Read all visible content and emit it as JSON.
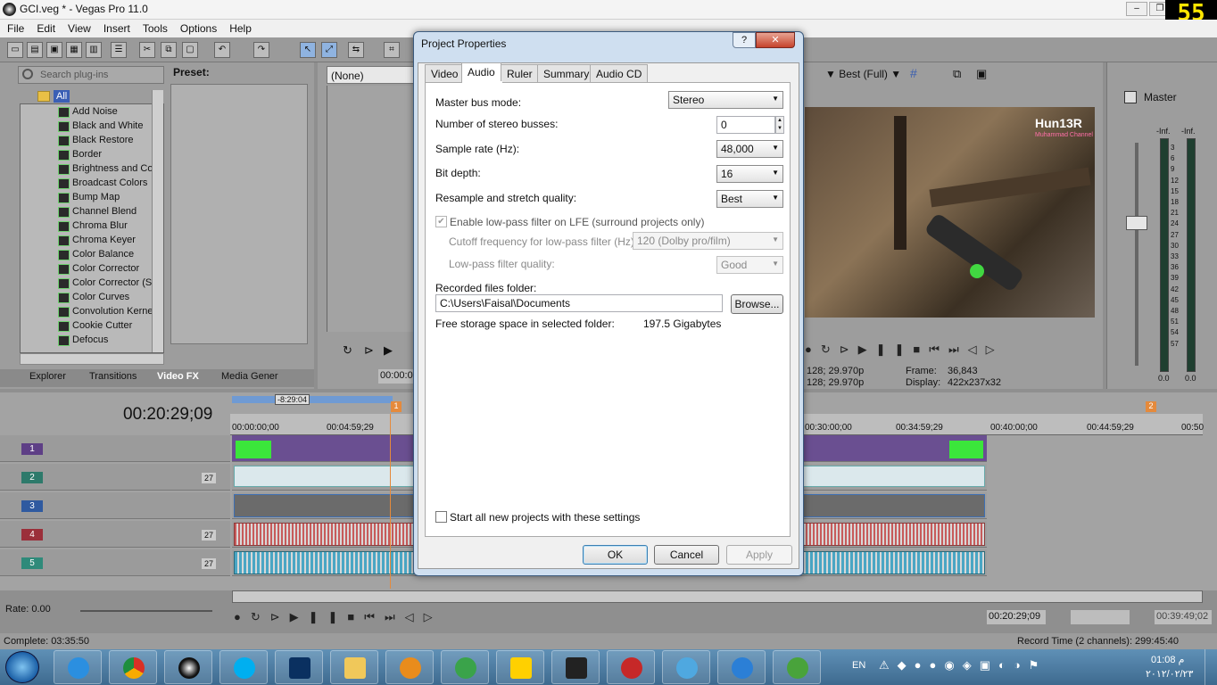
{
  "window": {
    "title": "GCI.veg * - Vegas Pro 11.0",
    "corner_counter": "55"
  },
  "menu": [
    "File",
    "Edit",
    "View",
    "Insert",
    "Tools",
    "Options",
    "Help"
  ],
  "plugins": {
    "search_placeholder": "Search plug-ins",
    "preset_label": "Preset:",
    "root": "All",
    "items": [
      "Add Noise",
      "Black and White",
      "Black Restore",
      "Border",
      "Brightness and Co",
      "Broadcast Colors",
      "Bump Map",
      "Channel Blend",
      "Chroma Blur",
      "Chroma Keyer",
      "Color Balance",
      "Color Corrector",
      "Color Corrector (S",
      "Color Curves",
      "Convolution Kerne",
      "Cookie Cutter",
      "Defocus"
    ]
  },
  "lower_tabs": [
    "Explorer",
    "Transitions",
    "Video FX",
    "Media Gener"
  ],
  "trimmer": {
    "combo": "(None)",
    "time": "00:00:0"
  },
  "preview": {
    "quality": "Best (Full)",
    "project_line1": "128; 29.970p",
    "project_line2": "128; 29.970p",
    "frame_label": "Frame:",
    "frame_value": "36,843",
    "display_label": "Display:",
    "display_value": "422x237x32",
    "overlay_logo": "Hun13R",
    "overlay_sub": "Muhammad Channel"
  },
  "master": {
    "label": "Master",
    "left_db": "-Inf.",
    "right_db": "-Inf.",
    "scale": [
      "3",
      "6",
      "9",
      "12",
      "15",
      "18",
      "21",
      "24",
      "27",
      "30",
      "33",
      "36",
      "39",
      "42",
      "45",
      "48",
      "51",
      "54",
      "57"
    ],
    "bottom_left": "0.0",
    "bottom_right": "0.0"
  },
  "dialog": {
    "title": "Project Properties",
    "help": "?",
    "close": "✕",
    "tabs": [
      "Video",
      "Audio",
      "Ruler",
      "Summary",
      "Audio CD"
    ],
    "active_tab": "Audio",
    "master_bus_label": "Master bus mode:",
    "master_bus_value": "Stereo",
    "stereo_busses_label": "Number of stereo busses:",
    "stereo_busses_value": "0",
    "sample_rate_label": "Sample rate (Hz):",
    "sample_rate_value": "48,000",
    "bit_depth_label": "Bit depth:",
    "bit_depth_value": "16",
    "resample_label": "Resample and stretch quality:",
    "resample_value": "Best",
    "lfe_label": "Enable low-pass filter on LFE (surround projects only)",
    "cutoff_label": "Cutoff frequency for low-pass filter (Hz):",
    "cutoff_value": "120 (Dolby pro/film)",
    "lp_quality_label": "Low-pass filter quality:",
    "lp_quality_value": "Good",
    "recorded_label": "Recorded files folder:",
    "recorded_value": "C:\\Users\\Faisal\\Documents",
    "browse": "Browse...",
    "free_label": "Free storage space in selected folder:",
    "free_value": "197.5 Gigabytes",
    "start_all_label": "Start all new projects with these settings",
    "ok": "OK",
    "cancel": "Cancel",
    "apply": "Apply"
  },
  "timeline": {
    "current_time": "00:20:29;09",
    "loop_length": "-8:29:04",
    "marker1": "1",
    "marker2": "2",
    "ruler": [
      "00:00:00;00",
      "00:04:59;29",
      "00:30:00;00",
      "00:34:59;29",
      "00:40:00;00",
      "00:44:59;29",
      "00:50"
    ],
    "tracks": [
      {
        "num": "1",
        "type": "video",
        "color": "#5e3f86",
        "level": ""
      },
      {
        "num": "2",
        "type": "audio",
        "color": "#2e7a6b",
        "level": "27"
      },
      {
        "num": "3",
        "type": "video",
        "color": "#2f5aa0",
        "level": ""
      },
      {
        "num": "4",
        "type": "audio",
        "color": "#9b2f3a",
        "level": "27"
      },
      {
        "num": "5",
        "type": "audio",
        "color": "#2f8a7a",
        "level": "27"
      }
    ],
    "rate": "Rate: 0.00",
    "cursor_time": "00:20:29;09",
    "end_time": "00:39:49;02"
  },
  "status": {
    "complete": "Complete: 03:35:50",
    "record_time": "Record Time (2 channels): 299:45:40"
  },
  "taskbar": {
    "lang": "EN",
    "time": "01:08 م",
    "date": "٢٠١٢/٠٢/٢٣"
  }
}
